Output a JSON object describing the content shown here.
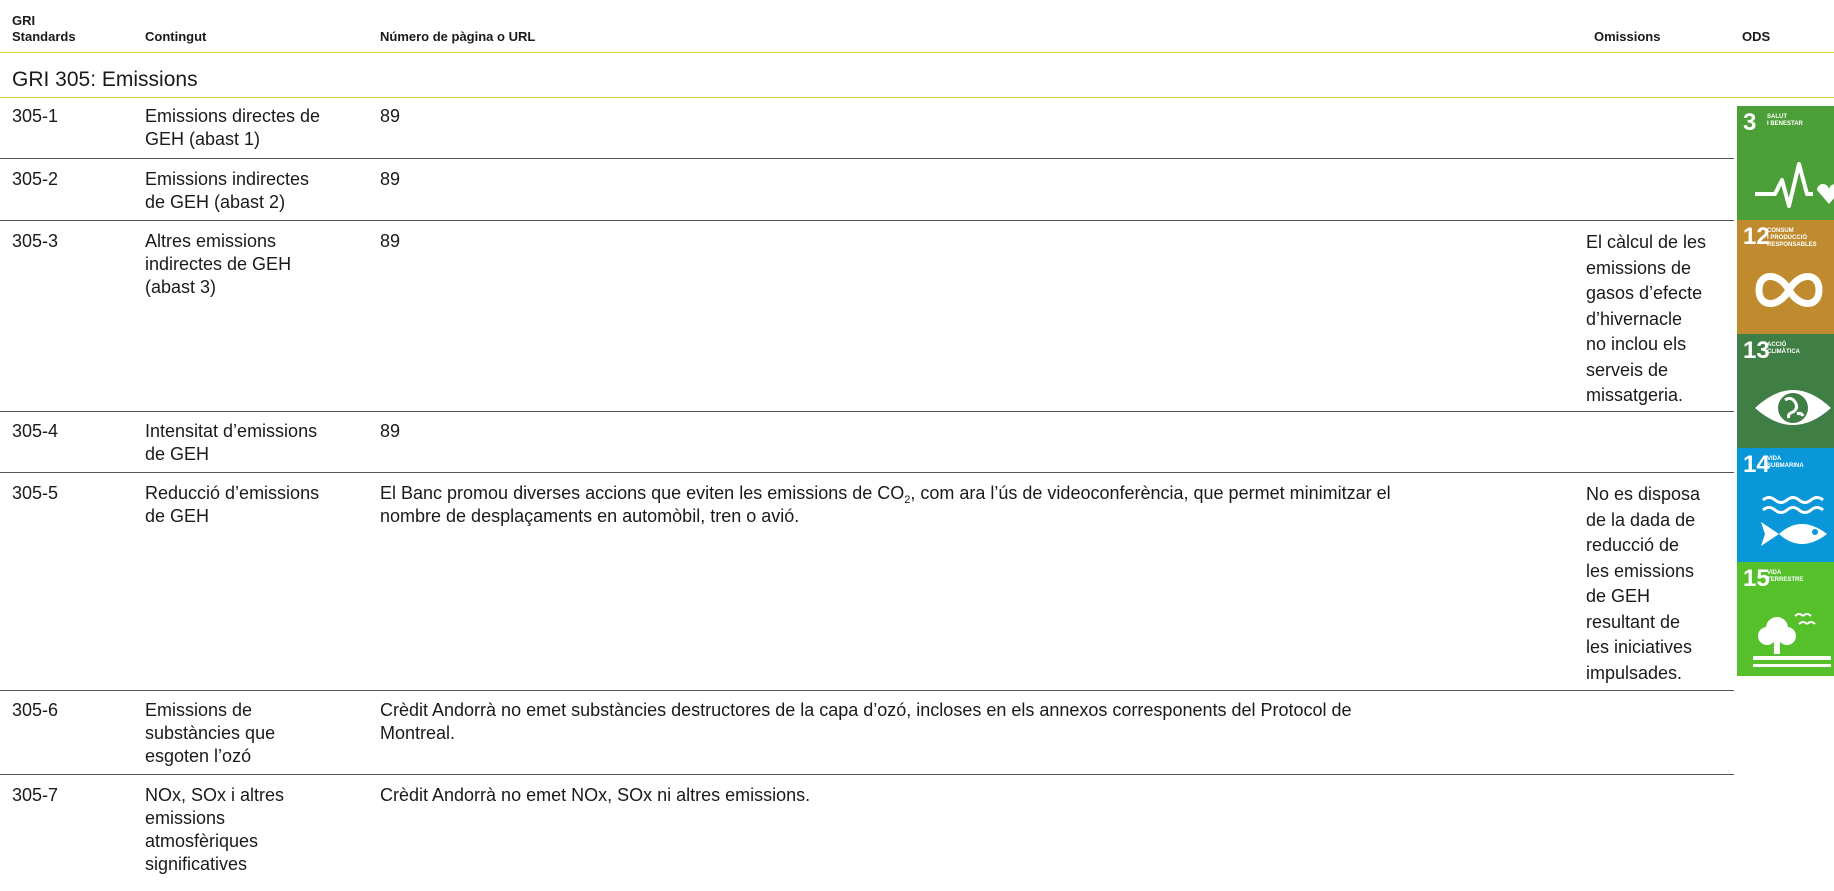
{
  "header": {
    "col1_line1": "GRI",
    "col1_line2": "Standards",
    "col2": "Contingut",
    "col3": "Número de pàgina o URL",
    "col4": "Omissions",
    "col5": "ODS"
  },
  "section_title": "GRI 305: Emissions",
  "rows": [
    {
      "code": "305-1",
      "content_lines": [
        "Emissions directes de",
        "GEH (abast 1)"
      ],
      "page": "89"
    },
    {
      "code": "305-2",
      "content_lines": [
        "Emissions indirectes",
        "de GEH (abast 2)"
      ],
      "page": "89"
    },
    {
      "code": "305-3",
      "content_lines": [
        "Altres emissions",
        "indirectes de GEH",
        "(abast 3)"
      ],
      "page": "89",
      "omission_lines": [
        "El càlcul de les",
        "emissions de",
        "gasos d’efecte",
        "d’hivernacle",
        "no inclou els",
        "serveis de",
        "missatgeria."
      ]
    },
    {
      "code": "305-4",
      "content_lines": [
        "Intensitat d’emissions",
        "de GEH"
      ],
      "page": "89"
    },
    {
      "code": "305-5",
      "content_lines": [
        "Reducció d’emissions",
        "de GEH"
      ],
      "page_line1_before": "El Banc promou diverses accions que eviten les emissions de CO",
      "page_line1_sub": "2",
      "page_line1_after": ", com ara l’ús de videoconferència, que permet minimitzar el",
      "page_line2": "nombre de desplaçaments en automòbil, tren o avió.",
      "omission_lines": [
        "No es disposa",
        "de la dada de",
        "reducció de",
        "les emissions",
        "de GEH",
        "resultant de",
        "les iniciatives",
        "impulsades."
      ]
    },
    {
      "code": "305-6",
      "content_lines": [
        "Emissions de",
        "substàncies que",
        "esgoten l’ozó"
      ],
      "page_lines": [
        "Crèdit Andorrà no emet substàncies destructores de la capa d’ozó, incloses en els annexos corresponents del Protocol de",
        "Montreal."
      ]
    },
    {
      "code": "305-7",
      "content_lines": [
        "NOx, SOx i altres",
        "emissions",
        "atmosfèriques",
        "significatives"
      ],
      "page_lines": [
        "Crèdit Andorrà no emet NOx, SOx ni altres emissions."
      ]
    }
  ],
  "sdg_icons": [
    {
      "number": "3",
      "label_lines": [
        "Salut",
        "i benestar"
      ],
      "color": "#4c9f38",
      "icon": "heartbeat-icon"
    },
    {
      "number": "12",
      "label_lines": [
        "Consum",
        "i producció",
        "responsables"
      ],
      "color": "#bf8b2e",
      "icon": "infinity-icon"
    },
    {
      "number": "13",
      "label_lines": [
        "Acció",
        "climàtica"
      ],
      "color": "#3f7e44",
      "icon": "eye-globe-icon"
    },
    {
      "number": "14",
      "label_lines": [
        "Vida",
        "submarina"
      ],
      "color": "#0a97d9",
      "icon": "fish-icon"
    },
    {
      "number": "15",
      "label_lines": [
        "Vida",
        "terrestre"
      ],
      "color": "#56c02b",
      "icon": "tree-icon"
    }
  ]
}
